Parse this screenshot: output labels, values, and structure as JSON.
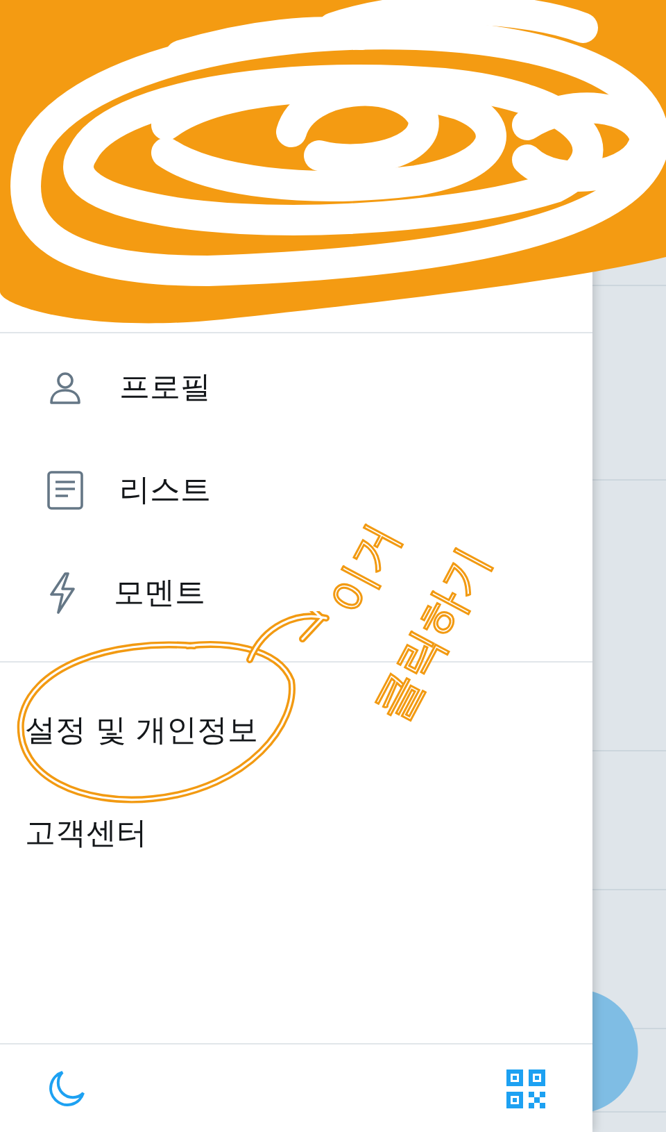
{
  "menu_primary": [
    {
      "label": "프로필"
    },
    {
      "label": "리스트"
    },
    {
      "label": "모멘트"
    }
  ],
  "menu_secondary": [
    {
      "label": "설정 및 개인정보"
    },
    {
      "label": "고객센터"
    }
  ],
  "annotation": {
    "lines": [
      "이거",
      "클릭하기"
    ]
  }
}
